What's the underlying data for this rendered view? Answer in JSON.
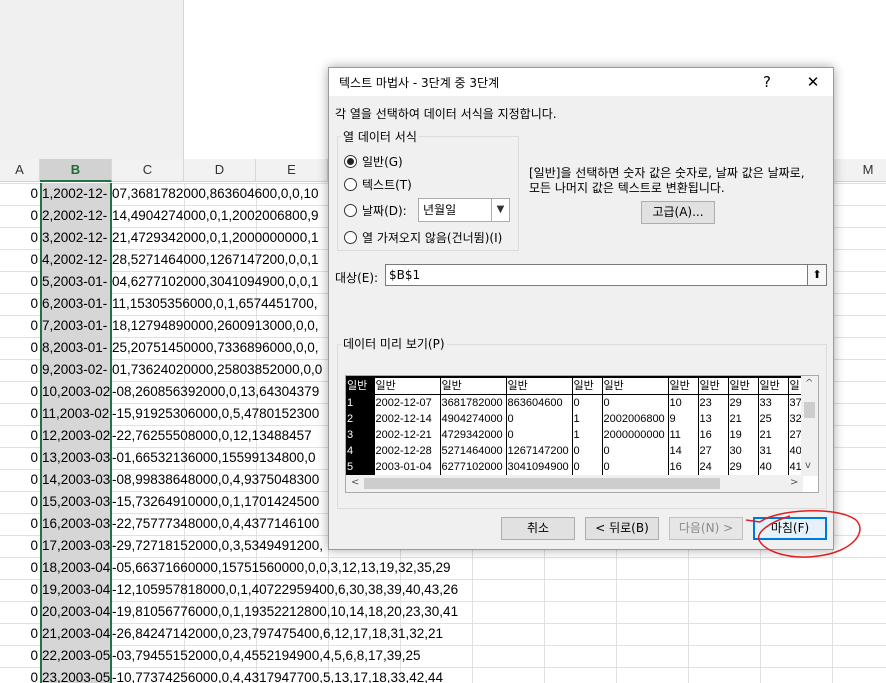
{
  "excel": {
    "column_headers": [
      "A",
      "B",
      "C",
      "D",
      "E",
      "M"
    ],
    "rows": [
      {
        "a": "0",
        "b": "1,2002-12-",
        "rest": "07,3681782000,863604600,0,0,10"
      },
      {
        "a": "0",
        "b": "2,2002-12-",
        "rest": "14,4904274000,0,1,2002006800,9"
      },
      {
        "a": "0",
        "b": "3,2002-12-",
        "rest": "21,4729342000,0,1,2000000000,1"
      },
      {
        "a": "0",
        "b": "4,2002-12-",
        "rest": "28,5271464000,1267147200,0,0,1"
      },
      {
        "a": "0",
        "b": "5,2003-01-",
        "rest": "04,6277102000,3041094900,0,0,1"
      },
      {
        "a": "0",
        "b": "6,2003-01-",
        "rest": "11,15305356000,0,1,6574451700,"
      },
      {
        "a": "0",
        "b": "7,2003-01-",
        "rest": "18,12794890000,2600913000,0,0,"
      },
      {
        "a": "0",
        "b": "8,2003-01-",
        "rest": "25,20751450000,7336896000,0,0,"
      },
      {
        "a": "0",
        "b": "9,2003-02-",
        "rest": "01,73624020000,25803852000,0,0"
      },
      {
        "a": "0",
        "b": "10,2003-02-",
        "rest": "-08,260856392000,0,13,64304379"
      },
      {
        "a": "0",
        "b": "11,2003-02-",
        "rest": "-15,91925306000,0,5,4780152300"
      },
      {
        "a": "0",
        "b": "12,2003-02-",
        "rest": "-22,76255508000,0,12,13488457"
      },
      {
        "a": "0",
        "b": "13,2003-03-",
        "rest": "-01,66532136000,15599134800,0"
      },
      {
        "a": "0",
        "b": "14,2003-03-",
        "rest": "-08,99838648000,0,4,9375048300"
      },
      {
        "a": "0",
        "b": "15,2003-03-",
        "rest": "-15,73264910000,0,1,1701424500"
      },
      {
        "a": "0",
        "b": "16,2003-03-",
        "rest": "-22,75777348000,0,4,4377146100"
      },
      {
        "a": "0",
        "b": "17,2003-03-",
        "rest": "-29,72718152000,0,3,5349491200,"
      },
      {
        "a": "0",
        "b": "18,2003-04-",
        "rest": "-05,66371660000,15751560000,0,0,3,12,13,19,32,35,29"
      },
      {
        "a": "0",
        "b": "19,2003-04-",
        "rest": "-12,105957818000,0,1,40722959400,6,30,38,39,40,43,26"
      },
      {
        "a": "0",
        "b": "20,2003-04-",
        "rest": "-19,81056776000,0,1,19352212800,10,14,18,20,23,30,41"
      },
      {
        "a": "0",
        "b": "21,2003-04-",
        "rest": "-26,84247142000,0,23,797475400,6,12,17,18,31,32,21"
      },
      {
        "a": "0",
        "b": "22,2003-05-",
        "rest": "-03,79455152000,0,4,4552194900,4,5,6,8,17,39,25"
      },
      {
        "a": "0",
        "b": "23,2003-05-",
        "rest": "-10,77374256000,0,4,4317947700,5,13,17,18,33,42,44"
      }
    ]
  },
  "dialog": {
    "title": "텍스트 마법사 - 3단계 중 3단계",
    "help_label": "?",
    "close_label": "✕",
    "instruction": "각 열을 선택하여 데이터 서식을 지정합니다.",
    "group_title": "열 데이터 서식",
    "radios": [
      {
        "label": "일반(G)",
        "checked": true
      },
      {
        "label": "텍스트(T)",
        "checked": false
      },
      {
        "label": "날짜(D):",
        "checked": false
      },
      {
        "label": "열 가져오지 않음(건너뜀)(I)",
        "checked": false
      }
    ],
    "date_format_value": "년월일",
    "description_line1": "[일반]을 선택하면 숫자 값은 숫자로, 날짜 값은 날짜로,",
    "description_line2": "모든 나머지 값은 텍스트로 변환됩니다.",
    "advanced_button": "고급(A)...",
    "destination_label": "대상(E):",
    "destination_value": "$B$1",
    "preview_label": "데이터 미리 보기(P)",
    "preview_headers": [
      "일반",
      "일반",
      "일반",
      "일반",
      "일반",
      "일반",
      "일반",
      "일반",
      "일반",
      "일반",
      "일"
    ],
    "preview_rows": [
      [
        "1",
        "2002-12-07",
        "3681782000",
        "863604600",
        "0",
        "0",
        "10",
        "23",
        "29",
        "33",
        "37"
      ],
      [
        "2",
        "2002-12-14",
        "4904274000",
        "0",
        "1",
        "2002006800",
        "9",
        "13",
        "21",
        "25",
        "32"
      ],
      [
        "3",
        "2002-12-21",
        "4729342000",
        "0",
        "1",
        "2000000000",
        "11",
        "16",
        "19",
        "21",
        "27"
      ],
      [
        "4",
        "2002-12-28",
        "5271464000",
        "1267147200",
        "0",
        "0",
        "14",
        "27",
        "30",
        "31",
        "40"
      ],
      [
        "5",
        "2003-01-04",
        "6277102000",
        "3041094900",
        "0",
        "0",
        "16",
        "24",
        "29",
        "40",
        "41"
      ]
    ],
    "buttons": {
      "cancel": "취소",
      "back": "< 뒤로(B)",
      "next": "다음(N) >",
      "finish": "마침(F)"
    }
  },
  "colors": {
    "excel_green": "#217346",
    "dialog_bg": "#f0f0f0",
    "default_button_border": "#0078d7",
    "annotation_red": "#e02020"
  }
}
